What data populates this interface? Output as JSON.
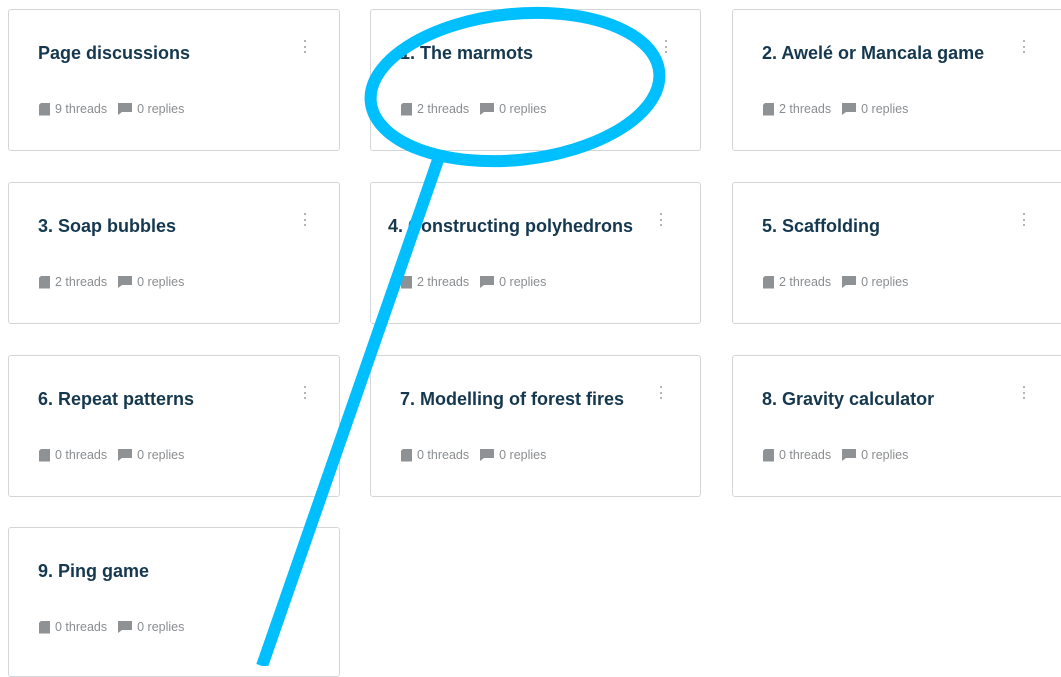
{
  "cards": [
    {
      "title": "Page discussions",
      "threads": "9 threads",
      "replies": "0 replies"
    },
    {
      "title": "1. The marmots",
      "threads": "2 threads",
      "replies": "0 replies"
    },
    {
      "title": "2. Awelé or Mancala game",
      "threads": "2 threads",
      "replies": "0 replies"
    },
    {
      "title": "3. Soap bubbles",
      "threads": "2 threads",
      "replies": "0 replies"
    },
    {
      "title": "4. Constructing polyhedrons",
      "threads": "2 threads",
      "replies": "0 replies"
    },
    {
      "title": "5. Scaffolding",
      "threads": "2 threads",
      "replies": "0 replies"
    },
    {
      "title": "6. Repeat patterns",
      "threads": "0 threads",
      "replies": "0 replies"
    },
    {
      "title": "7. Modelling of forest fires",
      "threads": "0 threads",
      "replies": "0 replies"
    },
    {
      "title": "8. Gravity calculator",
      "threads": "0 threads",
      "replies": "0 replies"
    },
    {
      "title": "9. Ping game",
      "threads": "0 threads",
      "replies": "0 replies"
    }
  ],
  "colors": {
    "title": "#15384f",
    "meta": "#8a8d90",
    "annotation": "#00bfff"
  }
}
